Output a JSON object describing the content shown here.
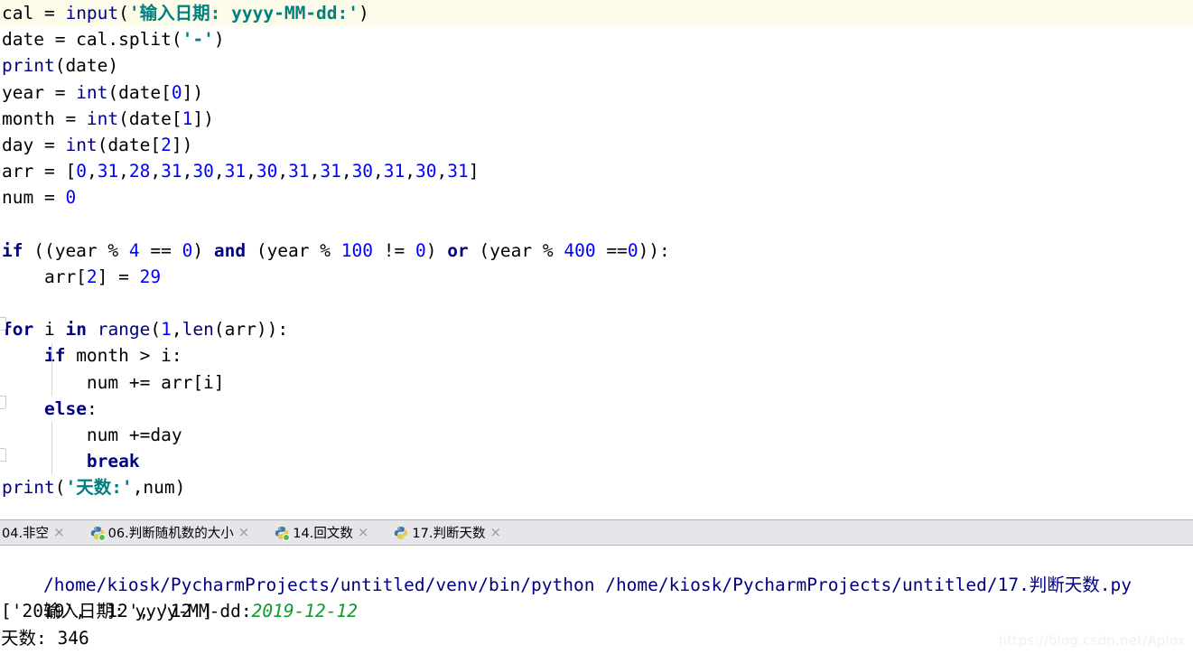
{
  "editor": {
    "caret_line_index": 0,
    "lines": [
      {
        "id": "line-1",
        "indent": 0,
        "tokens": [
          {
            "t": "cal = ",
            "c": "plain"
          },
          {
            "t": "input",
            "c": "builtin"
          },
          {
            "t": "(",
            "c": "plain"
          },
          {
            "t": "'输入日期: yyyy-MM-dd:'",
            "c": "str"
          },
          {
            "t": ")",
            "c": "plain"
          }
        ]
      },
      {
        "id": "line-2",
        "indent": 0,
        "tokens": [
          {
            "t": "date = cal.split(",
            "c": "plain"
          },
          {
            "t": "'-'",
            "c": "str"
          },
          {
            "t": ")",
            "c": "plain"
          }
        ]
      },
      {
        "id": "line-3",
        "indent": 0,
        "tokens": [
          {
            "t": "print",
            "c": "builtin"
          },
          {
            "t": "(date)",
            "c": "plain"
          }
        ]
      },
      {
        "id": "line-4",
        "indent": 0,
        "tokens": [
          {
            "t": "year = ",
            "c": "plain"
          },
          {
            "t": "int",
            "c": "builtin"
          },
          {
            "t": "(date[",
            "c": "plain"
          },
          {
            "t": "0",
            "c": "num"
          },
          {
            "t": "])",
            "c": "plain"
          }
        ]
      },
      {
        "id": "line-5",
        "indent": 0,
        "tokens": [
          {
            "t": "month = ",
            "c": "plain"
          },
          {
            "t": "int",
            "c": "builtin"
          },
          {
            "t": "(date[",
            "c": "plain"
          },
          {
            "t": "1",
            "c": "num"
          },
          {
            "t": "])",
            "c": "plain"
          }
        ]
      },
      {
        "id": "line-6",
        "indent": 0,
        "tokens": [
          {
            "t": "day = ",
            "c": "plain"
          },
          {
            "t": "int",
            "c": "builtin"
          },
          {
            "t": "(date[",
            "c": "plain"
          },
          {
            "t": "2",
            "c": "num"
          },
          {
            "t": "])",
            "c": "plain"
          }
        ]
      },
      {
        "id": "line-7",
        "indent": 0,
        "tokens": [
          {
            "t": "arr = [",
            "c": "plain"
          },
          {
            "t": "0",
            "c": "num"
          },
          {
            "t": ",",
            "c": "plain"
          },
          {
            "t": "31",
            "c": "num"
          },
          {
            "t": ",",
            "c": "plain"
          },
          {
            "t": "28",
            "c": "num"
          },
          {
            "t": ",",
            "c": "plain"
          },
          {
            "t": "31",
            "c": "num"
          },
          {
            "t": ",",
            "c": "plain"
          },
          {
            "t": "30",
            "c": "num"
          },
          {
            "t": ",",
            "c": "plain"
          },
          {
            "t": "31",
            "c": "num"
          },
          {
            "t": ",",
            "c": "plain"
          },
          {
            "t": "30",
            "c": "num"
          },
          {
            "t": ",",
            "c": "plain"
          },
          {
            "t": "31",
            "c": "num"
          },
          {
            "t": ",",
            "c": "plain"
          },
          {
            "t": "31",
            "c": "num"
          },
          {
            "t": ",",
            "c": "plain"
          },
          {
            "t": "30",
            "c": "num"
          },
          {
            "t": ",",
            "c": "plain"
          },
          {
            "t": "31",
            "c": "num"
          },
          {
            "t": ",",
            "c": "plain"
          },
          {
            "t": "30",
            "c": "num"
          },
          {
            "t": ",",
            "c": "plain"
          },
          {
            "t": "31",
            "c": "num"
          },
          {
            "t": "]",
            "c": "plain"
          }
        ]
      },
      {
        "id": "line-8",
        "indent": 0,
        "tokens": [
          {
            "t": "num = ",
            "c": "plain"
          },
          {
            "t": "0",
            "c": "num"
          }
        ]
      },
      {
        "id": "line-9",
        "indent": 0,
        "tokens": []
      },
      {
        "id": "line-10",
        "indent": 0,
        "tokens": [
          {
            "t": "if",
            "c": "kw"
          },
          {
            "t": " ((year % ",
            "c": "plain"
          },
          {
            "t": "4",
            "c": "num"
          },
          {
            "t": " == ",
            "c": "plain"
          },
          {
            "t": "0",
            "c": "num"
          },
          {
            "t": ") ",
            "c": "plain"
          },
          {
            "t": "and",
            "c": "kw"
          },
          {
            "t": " (year % ",
            "c": "plain"
          },
          {
            "t": "100",
            "c": "num"
          },
          {
            "t": " != ",
            "c": "plain"
          },
          {
            "t": "0",
            "c": "num"
          },
          {
            "t": ") ",
            "c": "plain"
          },
          {
            "t": "or",
            "c": "kw"
          },
          {
            "t": " (year % ",
            "c": "plain"
          },
          {
            "t": "400",
            "c": "num"
          },
          {
            "t": " ==",
            "c": "plain"
          },
          {
            "t": "0",
            "c": "num"
          },
          {
            "t": ")):",
            "c": "plain"
          }
        ]
      },
      {
        "id": "line-11",
        "indent": 0,
        "tokens": [
          {
            "t": "    arr[",
            "c": "plain"
          },
          {
            "t": "2",
            "c": "num"
          },
          {
            "t": "] = ",
            "c": "plain"
          },
          {
            "t": "29",
            "c": "num"
          }
        ]
      },
      {
        "id": "line-12",
        "indent": 0,
        "tokens": []
      },
      {
        "id": "line-13",
        "indent": 0,
        "tokens": [
          {
            "t": "for",
            "c": "kw"
          },
          {
            "t": " i ",
            "c": "plain"
          },
          {
            "t": "in",
            "c": "kw"
          },
          {
            "t": " ",
            "c": "plain"
          },
          {
            "t": "range",
            "c": "builtin"
          },
          {
            "t": "(",
            "c": "plain"
          },
          {
            "t": "1",
            "c": "num"
          },
          {
            "t": ",",
            "c": "plain"
          },
          {
            "t": "len",
            "c": "builtin"
          },
          {
            "t": "(arr)):",
            "c": "plain"
          }
        ]
      },
      {
        "id": "line-14",
        "indent": 0,
        "tokens": [
          {
            "t": "    ",
            "c": "plain"
          },
          {
            "t": "if",
            "c": "kw"
          },
          {
            "t": " month > i:",
            "c": "plain"
          }
        ]
      },
      {
        "id": "line-15",
        "indent": 0,
        "tokens": [
          {
            "t": "        num += arr[i]",
            "c": "plain"
          }
        ]
      },
      {
        "id": "line-16",
        "indent": 0,
        "tokens": [
          {
            "t": "    ",
            "c": "plain"
          },
          {
            "t": "else",
            "c": "kw"
          },
          {
            "t": ":",
            "c": "plain"
          }
        ]
      },
      {
        "id": "line-17",
        "indent": 0,
        "tokens": [
          {
            "t": "        num +=day",
            "c": "plain"
          }
        ]
      },
      {
        "id": "line-18",
        "indent": 0,
        "tokens": [
          {
            "t": "        ",
            "c": "plain"
          },
          {
            "t": "break",
            "c": "kw"
          }
        ]
      },
      {
        "id": "line-19",
        "indent": 0,
        "tokens": [
          {
            "t": "print",
            "c": "builtin"
          },
          {
            "t": "(",
            "c": "plain"
          },
          {
            "t": "'天数:'",
            "c": "str"
          },
          {
            "t": ",num)",
            "c": "plain"
          }
        ]
      }
    ]
  },
  "tabs": [
    {
      "label": "04.非空",
      "icon": "python-file-icon",
      "modified": false,
      "active": false,
      "close": "×",
      "show_icon": false
    },
    {
      "label": "06.判断随机数的大小",
      "icon": "python-file-icon",
      "modified": true,
      "active": false,
      "close": "×",
      "show_icon": true
    },
    {
      "label": "14.回文数",
      "icon": "python-file-icon",
      "modified": true,
      "active": false,
      "close": "×",
      "show_icon": true
    },
    {
      "label": "17.判断天数",
      "icon": "python-file-icon",
      "modified": false,
      "active": true,
      "close": "×",
      "show_icon": true
    }
  ],
  "console": {
    "command_line": {
      "interpreter": "/home/kiosk/PycharmProjects/untitled/venv/bin/python",
      "script": "/home/kiosk/PycharmProjects/untitled/17.判断天数.py"
    },
    "prompt_line": {
      "prompt": "输入日期: yyyy-MM-dd:",
      "user_input": "2019-12-12"
    },
    "output_lines": [
      "['2019', '12', '12']",
      "天数: 346"
    ]
  },
  "watermark": "https://blog.csdn.net/Aplox",
  "colors": {
    "keyword": "#000080",
    "builtin": "#000080",
    "number": "#0000FF",
    "string": "#008080",
    "caret_line_bg": "#FCFAE8",
    "console_path": "#000080",
    "console_input": "#0A9C2E",
    "tabbar_bg": "#E6E6EA"
  }
}
